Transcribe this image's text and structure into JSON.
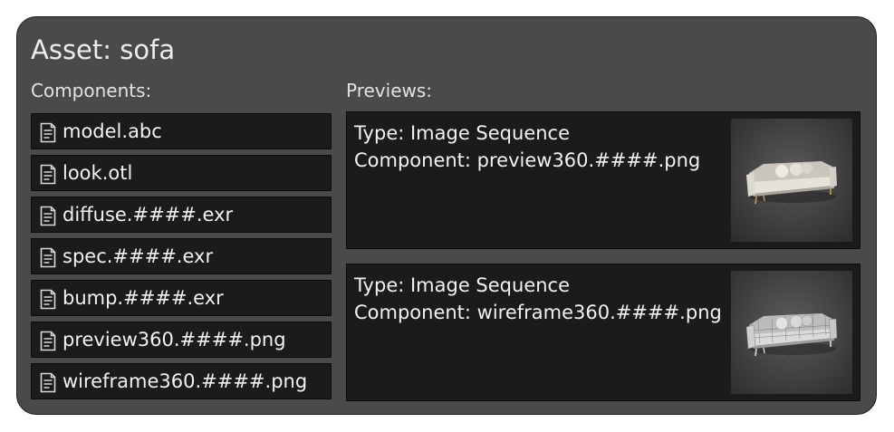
{
  "asset": {
    "title": "Asset: sofa"
  },
  "components": {
    "label": "Components:",
    "items": [
      {
        "label": "model.abc",
        "icon": "document-icon"
      },
      {
        "label": "look.otl",
        "icon": "document-icon"
      },
      {
        "label": "diffuse.####.exr",
        "icon": "document-icon"
      },
      {
        "label": "spec.####.exr",
        "icon": "document-icon"
      },
      {
        "label": "bump.####.exr",
        "icon": "document-icon"
      },
      {
        "label": "preview360.####.png",
        "icon": "document-icon"
      },
      {
        "label": "wireframe360.####.png",
        "icon": "document-icon"
      }
    ]
  },
  "previews": {
    "label": "Previews:",
    "items": [
      {
        "type_line": "Type: Image Sequence",
        "component_line": "Component: preview360.####.png",
        "thumbnail": "sofa-render-thumbnail"
      },
      {
        "type_line": "Type: Image Sequence",
        "component_line": "Component: wireframe360.####.png",
        "thumbnail": "sofa-wireframe-thumbnail"
      }
    ]
  },
  "colors": {
    "panel_background": "#4a4a4a",
    "item_background": "#1b1b1b",
    "text": "#f2f2f2"
  }
}
